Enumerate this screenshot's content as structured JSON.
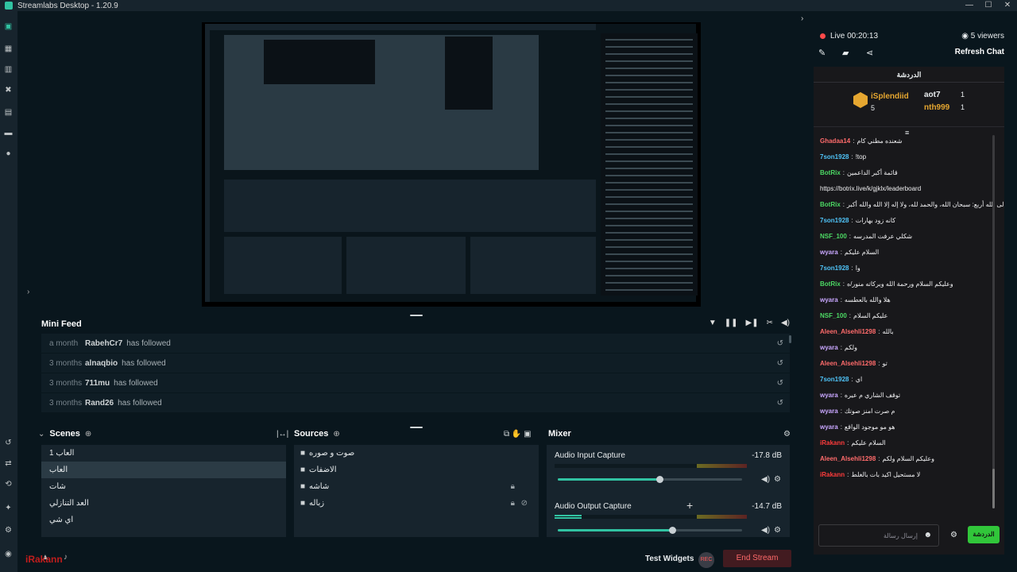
{
  "window": {
    "title": "Streamlabs Desktop - 1.20.9",
    "controls": [
      "—",
      "☐",
      "✕"
    ]
  },
  "mini_feed": {
    "title": "Mini Feed",
    "events": [
      {
        "time": "a month",
        "user": "RabehCr7",
        "action": "has followed"
      },
      {
        "time": "3 months",
        "user": "alnaqbio",
        "action": "has followed"
      },
      {
        "time": "3 months",
        "user": "711mu",
        "action": "has followed"
      },
      {
        "time": "3 months",
        "user": "Rand26",
        "action": "has followed"
      }
    ]
  },
  "scenes": {
    "title": "Scenes",
    "items": [
      "العاب 1",
      "العاب",
      "شات",
      "العد التنازلي",
      "اي شي"
    ]
  },
  "sources": {
    "title": "Sources",
    "items": [
      "صوت و صوره",
      "الاضفات",
      "شاشه",
      "زباله"
    ]
  },
  "mixer": {
    "title": "Mixer",
    "channels": [
      {
        "name": "Audio Input Capture",
        "db": "-17.8 dB",
        "level": 0.0,
        "volume": 0.55
      },
      {
        "name": "Audio Output Capture",
        "db": "-14.7 dB",
        "level": 0.14,
        "volume": 0.62
      }
    ]
  },
  "footer": {
    "test_widgets": "Test Widgets",
    "end_stream": "End Stream",
    "watermark": "iRakann"
  },
  "chat": {
    "live_label": "Live 00:20:13",
    "viewers": "5 viewers",
    "refresh": "Refresh Chat",
    "header": "الدردشة",
    "leaderboard": [
      {
        "name": "iSplendiid",
        "score": "5"
      },
      {
        "name": "aot7",
        "score": "1"
      },
      {
        "name": "nth999",
        "score": "1"
      }
    ],
    "input_placeholder": "إرسال رسالة",
    "send_label": "الدردشة",
    "messages": [
      {
        "user": "Ghadaa14",
        "color": "#ff6b6b",
        "text": "شعنده مطني كام"
      },
      {
        "user": "7son1928",
        "color": "#4fc3f7",
        "text": "!top"
      },
      {
        "user": "BotRix",
        "color": "#4cd964",
        "text": "قائمة أكبر الداعمين"
      },
      {
        "user": "",
        "color": "#ffffff",
        "text": "https://botrix.live/k/gjklx/leaderboard"
      },
      {
        "user": "BotRix",
        "color": "#4cd964",
        "text": "قال النبي ﷺ: أحبُّ الكلام إلى الله أربع: سبحان الله، والحمد لله، ولا إله إلا الله والله أكبر"
      },
      {
        "user": "7son1928",
        "color": "#4fc3f7",
        "text": "كانه زود بهارات"
      },
      {
        "user": "NSF_100",
        "color": "#4cd964",
        "text": "شكلي عرفت المدرسه"
      },
      {
        "user": "wyara",
        "color": "#c9a7ff",
        "text": "السلام عليكم"
      },
      {
        "user": "7son1928",
        "color": "#4fc3f7",
        "text": "وا"
      },
      {
        "user": "BotRix",
        "color": "#4cd964",
        "text": "وعليكم السلام ورحمة الله وبركاته منور/ه"
      },
      {
        "user": "wyara",
        "color": "#c9a7ff",
        "text": "هلا والله بالعطسه"
      },
      {
        "user": "NSF_100",
        "color": "#4cd964",
        "text": "عليكم السلام"
      },
      {
        "user": "Aleen_Alsehli1298",
        "color": "#ff6b6b",
        "text": "بالله"
      },
      {
        "user": "wyara",
        "color": "#c9a7ff",
        "text": "ولكم"
      },
      {
        "user": "Aleen_Alsehli1298",
        "color": "#ff6b6b",
        "text": "تو"
      },
      {
        "user": "7son1928",
        "color": "#4fc3f7",
        "text": "اي"
      },
      {
        "user": "wyara",
        "color": "#c9a7ff",
        "text": "توقف الشاري م عيره"
      },
      {
        "user": "wyara",
        "color": "#c9a7ff",
        "text": "م صرت امنز صوتك"
      },
      {
        "user": "wyara",
        "color": "#c9a7ff",
        "text": "هو مو موجود الواقع"
      },
      {
        "user": "iRakann",
        "color": "#ff3b3b",
        "text": "السلام عليكم"
      },
      {
        "user": "Aleen_Alsehli1298",
        "color": "#ff6b6b",
        "text": "وعليكم السلام ولكم"
      },
      {
        "user": "iRakann",
        "color": "#ff3b3b",
        "text": "لا مستحيل اكيد بات بالغلط"
      }
    ]
  },
  "colors": {
    "accent": "#31c3a2",
    "end_stream": "#421b20",
    "send_button": "#31c63a"
  },
  "icons": {
    "nav": [
      "editor-icon",
      "themes-icon",
      "library-icon",
      "tools-icon",
      "grid-icon",
      "store-icon",
      "media-icon",
      "layout-icon"
    ]
  }
}
